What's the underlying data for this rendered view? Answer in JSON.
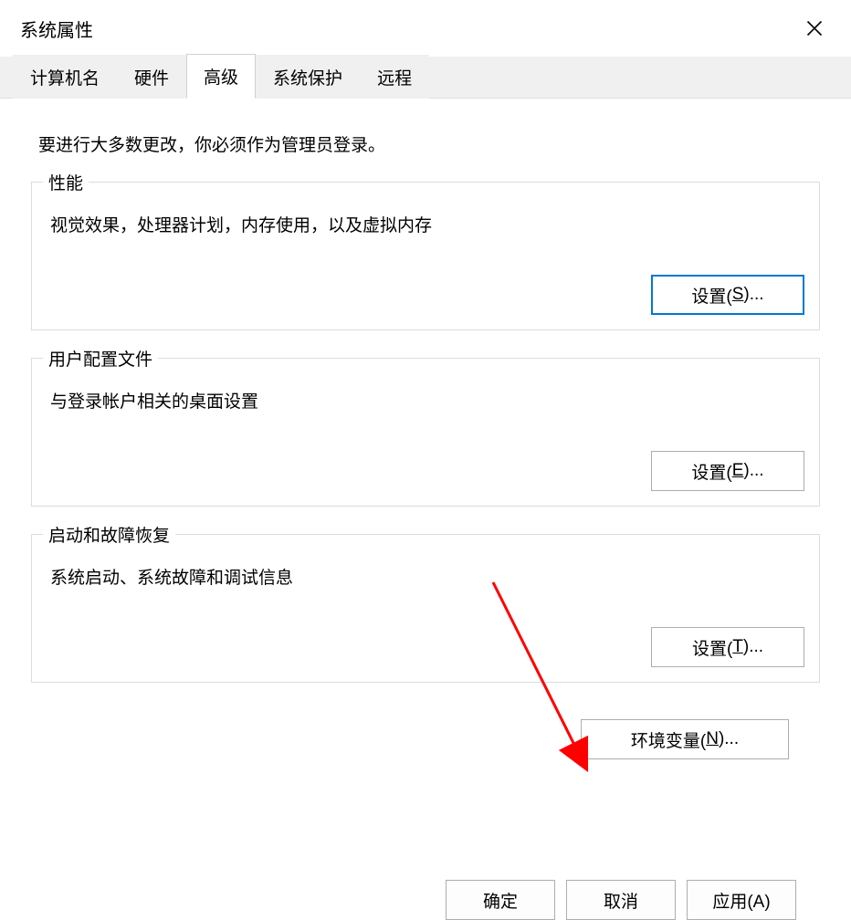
{
  "window": {
    "title": "系统属性"
  },
  "tabs": {
    "items": [
      {
        "label": "计算机名"
      },
      {
        "label": "硬件"
      },
      {
        "label": "高级",
        "active": true
      },
      {
        "label": "系统保护"
      },
      {
        "label": "远程"
      }
    ]
  },
  "content": {
    "intro": "要进行大多数更改，你必须作为管理员登录。",
    "performance": {
      "legend": "性能",
      "desc": "视觉效果，处理器计划，内存使用，以及虚拟内存",
      "button_prefix": "设置(",
      "button_hotkey": "S",
      "button_suffix": ")..."
    },
    "userprofile": {
      "legend": "用户配置文件",
      "desc": "与登录帐户相关的桌面设置",
      "button_prefix": "设置(",
      "button_hotkey": "E",
      "button_suffix": ")..."
    },
    "startup": {
      "legend": "启动和故障恢复",
      "desc": "系统启动、系统故障和调试信息",
      "button_prefix": "设置(",
      "button_hotkey": "T",
      "button_suffix": ")..."
    },
    "env": {
      "button_prefix": "环境变量(",
      "button_hotkey": "N",
      "button_suffix": ")..."
    }
  },
  "footer": {
    "ok": "确定",
    "cancel": "取消",
    "apply": "应用(A)"
  }
}
